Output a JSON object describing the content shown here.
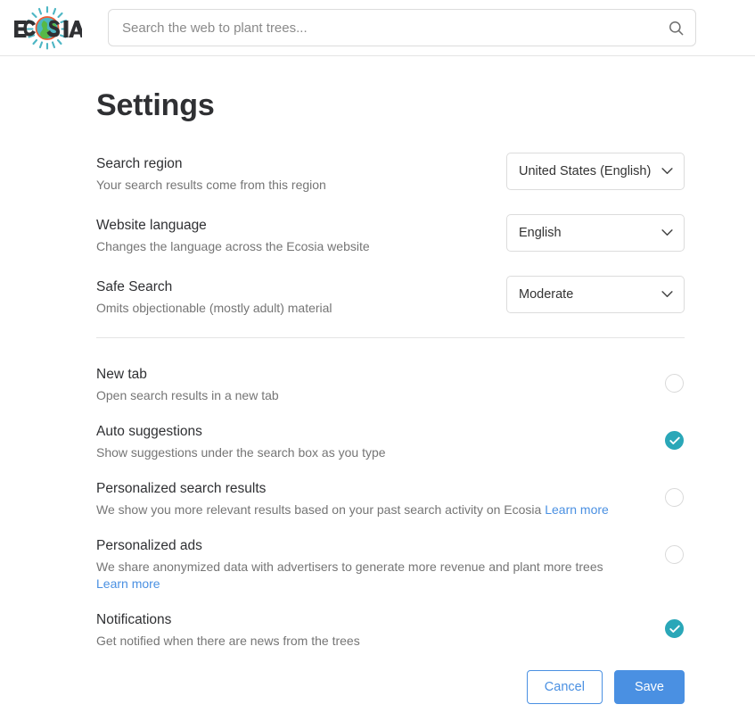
{
  "header": {
    "logo_text": "ECOSIA",
    "logo_icon": "ecosia-globe-logo",
    "search": {
      "placeholder": "Search the web to plant trees...",
      "value": "",
      "button_icon": "search-icon"
    }
  },
  "page": {
    "title": "Settings"
  },
  "select_settings": [
    {
      "title": "Search region",
      "description": "Your search results come from this region",
      "value": "United States (English)",
      "options": [
        "United States (English)"
      ]
    },
    {
      "title": "Website language",
      "description": "Changes the language across the Ecosia website",
      "value": "English",
      "options": [
        "English"
      ]
    },
    {
      "title": "Safe Search",
      "description": "Omits objectionable (mostly adult) material",
      "value": "Moderate",
      "options": [
        "Moderate"
      ]
    }
  ],
  "toggle_settings": [
    {
      "title": "New tab",
      "description": "Open search results in a new tab",
      "link_text": "",
      "link_on_new_line": false,
      "checked": false
    },
    {
      "title": "Auto suggestions",
      "description": "Show suggestions under the search box as you type",
      "link_text": "",
      "link_on_new_line": false,
      "checked": true
    },
    {
      "title": "Personalized search results",
      "description": "We show you more relevant results based on your past search activity on Ecosia",
      "link_text": "Learn more",
      "link_on_new_line": false,
      "checked": false
    },
    {
      "title": "Personalized ads",
      "description": "We share anonymized data with advertisers to generate more revenue and plant more trees",
      "link_text": "Learn more",
      "link_on_new_line": true,
      "checked": false
    },
    {
      "title": "Notifications",
      "description": "Get notified when there are news from the trees",
      "link_text": "",
      "link_on_new_line": false,
      "checked": true
    }
  ],
  "footer": {
    "cancel_label": "Cancel",
    "save_label": "Save"
  },
  "colors": {
    "accent_teal": "#2aa7b8",
    "link_blue": "#4a90e2",
    "button_blue": "#4a90e2",
    "text_primary": "#2f3033",
    "text_secondary": "#757575",
    "border": "#dcdcdc"
  }
}
